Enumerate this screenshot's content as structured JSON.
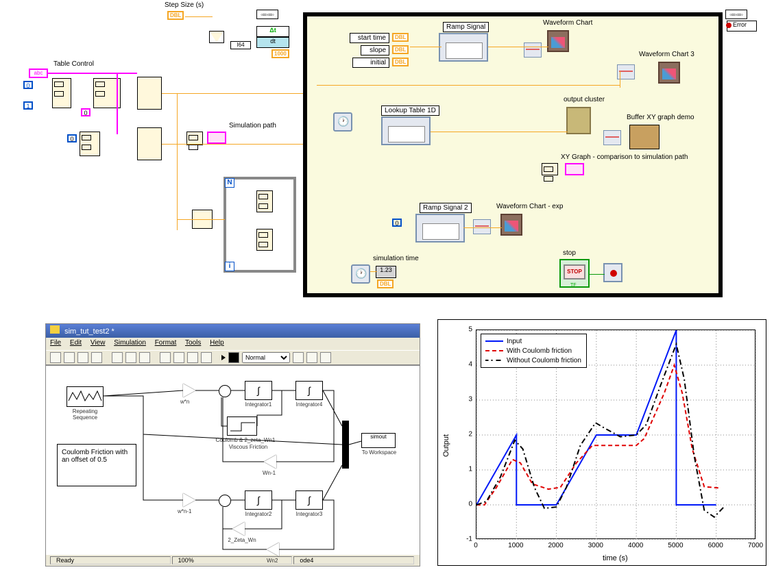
{
  "labview": {
    "step_size_label": "Step Size (s)",
    "step_size_type": "DBL",
    "delta_t": "Δt",
    "dt": "dt",
    "i64": "I64",
    "thousand": "1000",
    "table_control_label": "Table Control",
    "abc": "abc",
    "simulation_path_label": "Simulation path",
    "zero": "0",
    "one": "1",
    "N": "N",
    "i": "i",
    "error_label": "Error",
    "loop": {
      "start_time": "start time",
      "slope": "slope",
      "initial": "initial",
      "ramp_signal": "Ramp Signal",
      "waveform_chart": "Waveform Chart",
      "waveform_chart3": "Waveform Chart 3",
      "lookup_table": "Lookup Table 1D",
      "output_cluster": "output cluster",
      "buffer_xy": "Buffer XY graph demo",
      "xy_graph_comparison": "XY Graph - comparison to simulation path",
      "ramp_signal2": "Ramp Signal 2",
      "waveform_chart_exp": "Waveform Chart - exp",
      "simulation_time": "simulation time",
      "stop": "stop",
      "one_two_three": "1.23",
      "dbl": "DBL",
      "stop_btn": "STOP",
      "TF": "TF"
    }
  },
  "simulink": {
    "title": "sim_tut_test2 *",
    "menu": {
      "file": "File",
      "edit": "Edit",
      "view": "View",
      "simulation": "Simulation",
      "format": "Format",
      "tools": "Tools",
      "help": "Help"
    },
    "mode": "Normal",
    "annotation": "Coulomb Friction with an offset of 0.5",
    "blocks": {
      "repeating": "Repeating Sequence",
      "wn": "w*n",
      "wn1": "w*n-1",
      "integrator1": "Integrator1",
      "integrator4": "Integrator4",
      "integrator2": "Integrator2",
      "integrator3": "Integrator3",
      "coulomb": "Coulomb & 2_zeta_Wn1",
      "viscous": "Viscous Friction",
      "wn1_gain": "Wn-1",
      "wn2": "Wn2",
      "two_zeta": "2_Zeta_Wn",
      "simout": "simout",
      "to_workspace": "To Workspace"
    },
    "status": {
      "ready": "Ready",
      "pct": "100%",
      "solver": "ode4"
    }
  },
  "chart_data": {
    "type": "line",
    "xlabel": "time (s)",
    "ylabel": "Output",
    "xlim": [
      0,
      7000
    ],
    "ylim": [
      -1,
      5
    ],
    "xticks": [
      0,
      1000,
      2000,
      3000,
      4000,
      5000,
      6000,
      7000
    ],
    "yticks": [
      -1,
      0,
      1,
      2,
      3,
      4,
      5
    ],
    "legend": [
      "Input",
      "With Coulomb friction",
      "Without Coulomb friction"
    ],
    "series": [
      {
        "name": "Input",
        "color": "#0018F8",
        "style": "solid",
        "x": [
          0,
          1000,
          1000,
          2000,
          3000,
          3000,
          4000,
          5000,
          5000,
          6000
        ],
        "y": [
          0,
          2.0,
          0,
          0,
          2.0,
          2.0,
          2.0,
          5.0,
          0,
          0
        ]
      },
      {
        "name": "With Coulomb friction",
        "color": "#E00000",
        "style": "dashed",
        "x": [
          0,
          200,
          500,
          900,
          1100,
          1400,
          1800,
          2100,
          2500,
          2900,
          3200,
          4000,
          4200,
          4700,
          4950,
          5150,
          5400,
          5700,
          6100
        ],
        "y": [
          0,
          0.0,
          0.5,
          1.3,
          1.2,
          0.6,
          0.45,
          0.5,
          1.2,
          1.7,
          1.7,
          1.7,
          1.9,
          3.2,
          4.0,
          3.2,
          1.6,
          0.52,
          0.48
        ]
      },
      {
        "name": "Without Coulomb friction",
        "color": "#000000",
        "style": "dashdot",
        "x": [
          0,
          250,
          600,
          960,
          1160,
          1450,
          1700,
          2000,
          2250,
          2600,
          2980,
          3200,
          3600,
          4000,
          4250,
          4600,
          5000,
          5200,
          5450,
          5700,
          5950,
          6200
        ],
        "y": [
          0,
          0.1,
          0.8,
          1.85,
          1.6,
          0.5,
          -0.1,
          -0.06,
          0.5,
          1.7,
          2.35,
          2.2,
          1.95,
          2.0,
          2.3,
          3.4,
          4.6,
          3.6,
          1.4,
          -0.15,
          -0.35,
          -0.05
        ]
      }
    ]
  }
}
